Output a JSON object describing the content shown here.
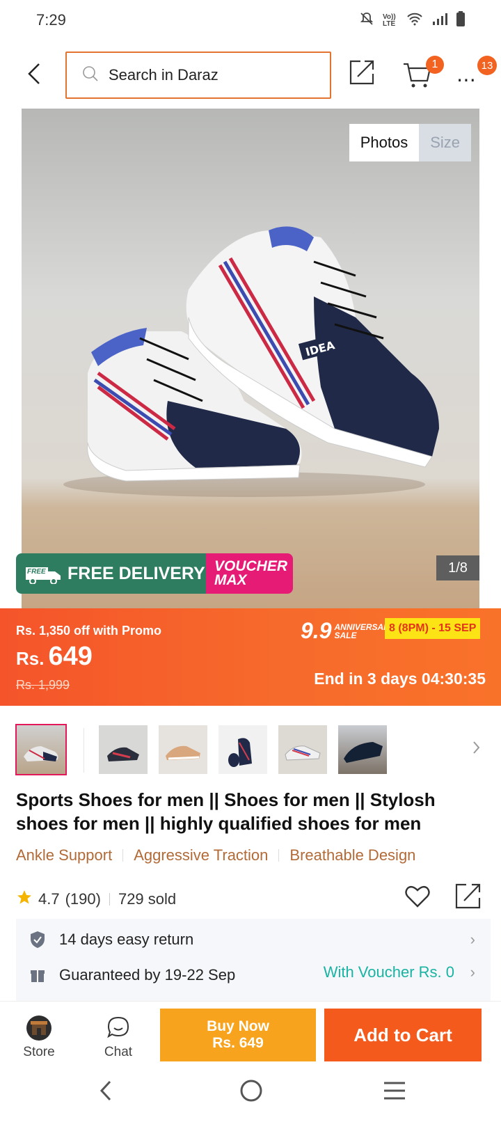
{
  "status_bar": {
    "time": "7:29",
    "volte_label": "Vo)) LTE"
  },
  "header": {
    "search_placeholder": "Search in Daraz",
    "cart_count": "1",
    "more_count": "13"
  },
  "gallery": {
    "tab_photos": "Photos",
    "tab_size": "Size",
    "counter": "1/8",
    "free_delivery_tag": "FREE",
    "free_delivery_label": "FREE DELIVERY",
    "voucher_label_1": "VOUCHER",
    "voucher_label_2": "MAX"
  },
  "price": {
    "promo_text": "Rs. 1,350 off with Promo",
    "currency": "Rs.",
    "current": "649",
    "original": "Rs. 1,999",
    "sale_number": "9.9",
    "sale_name_1": "ANNIVERSARY",
    "sale_name_2": "SALE",
    "sale_dates": "8 (8PM) - 15 SEP",
    "countdown": "End in 3 days 04:30:35"
  },
  "product": {
    "title": "Sports Shoes for men || Shoes for men || Stylosh shoes for men || highly qualified shoes for men",
    "features": [
      "Ankle Support",
      "Aggressive Traction",
      "Breathable Design"
    ],
    "rating": "4.7",
    "review_count": "(190)",
    "sold": "729 sold"
  },
  "services": {
    "return_label": "14 days easy return",
    "delivery_label": "Guaranteed by 19-22 Sep",
    "delivery_voucher": "With Voucher Rs. 0"
  },
  "bottom_bar": {
    "store_label": "Store",
    "chat_label": "Chat",
    "buy_now_label": "Buy Now",
    "buy_now_price": "Rs. 649",
    "add_to_cart_label": "Add to Cart"
  },
  "colors": {
    "accent": "#f55a1d",
    "buy_now": "#f8a31e",
    "feature_text": "#b26a37",
    "voucher_teal": "#19b3a3",
    "free_delivery_green": "#2f7d61",
    "voucher_pink": "#e51b76"
  }
}
